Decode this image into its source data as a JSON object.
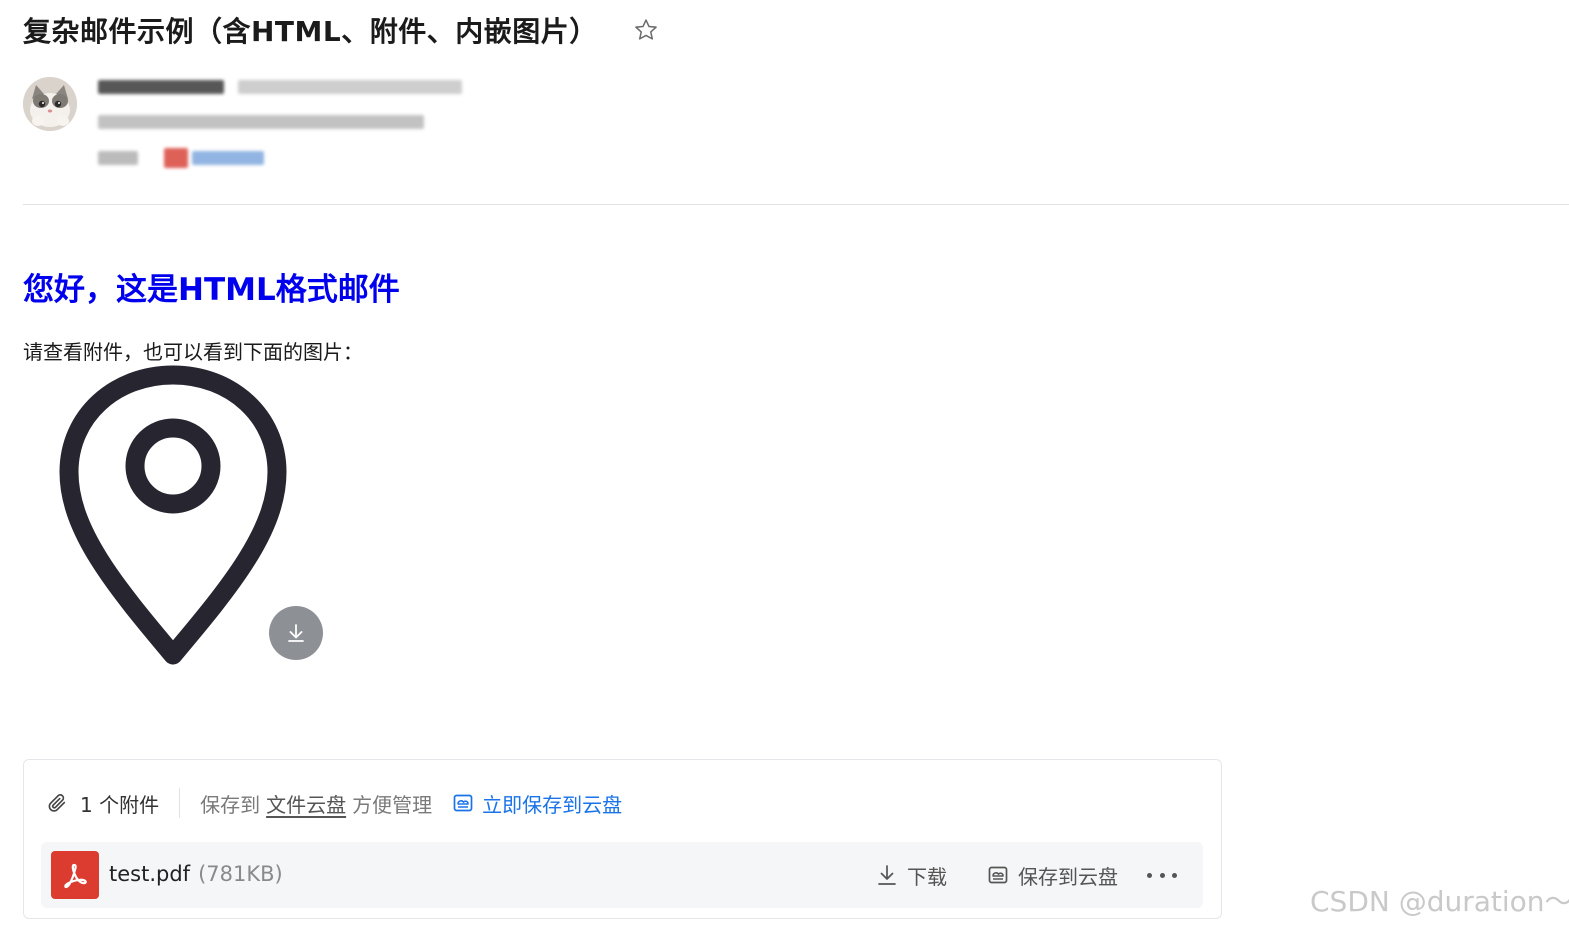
{
  "email": {
    "subject": "复杂邮件示例（含HTML、附件、内嵌图片）",
    "star_icon": "star-outline-icon"
  },
  "body": {
    "greeting": "您好，这是HTML格式邮件",
    "paragraph": "请查看附件，也可以看到下面的图片：",
    "inline_image_icon": "location-pin-icon",
    "image_download_icon": "download-icon"
  },
  "attachments": {
    "count_label": "1 个附件",
    "save_prefix": "保存到",
    "cloud_link": "文件云盘",
    "save_suffix": "方便管理",
    "save_now_label": "立即保存到云盘",
    "files": [
      {
        "name": "test.pdf",
        "size": "(781KB)",
        "download_label": "下载",
        "save_cloud_label": "保存到云盘"
      }
    ]
  },
  "watermark": "CSDN @duration～",
  "colors": {
    "greeting": "#0000ee",
    "link_blue": "#1a73e8",
    "pdf_red": "#dc3b2f"
  }
}
